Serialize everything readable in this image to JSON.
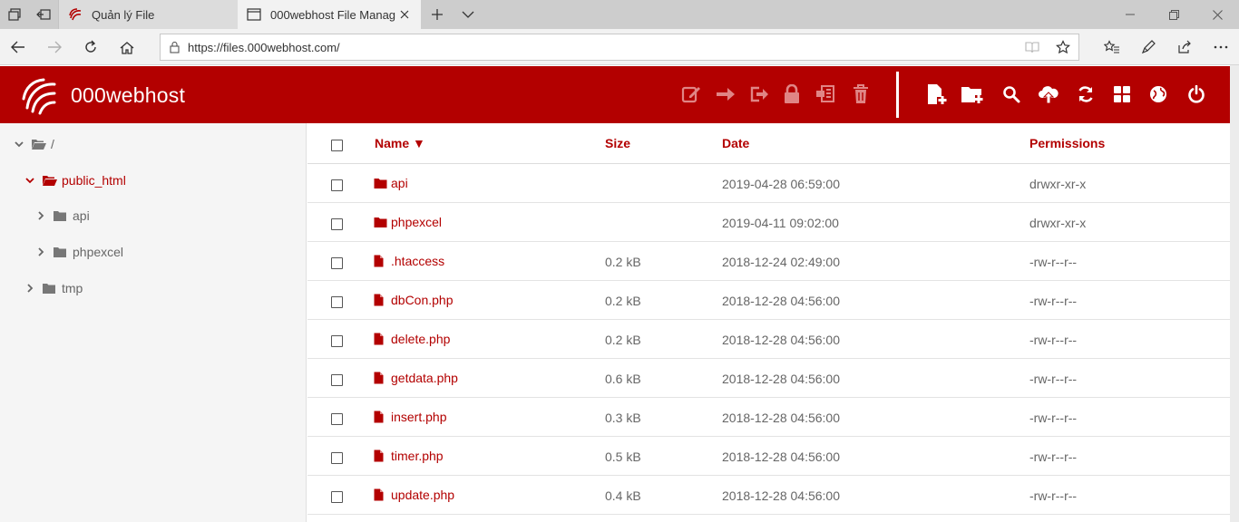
{
  "browser": {
    "tabs": [
      {
        "title": "Quản lý File"
      },
      {
        "title": "000webhost File Manag"
      }
    ],
    "url": "https://files.000webhost.com/"
  },
  "app": {
    "brand": "000webhost",
    "colors": {
      "primary": "#b30000",
      "muted_icon": "#e08585",
      "text_muted": "#666666"
    }
  },
  "tree": [
    {
      "label": "/"
    },
    {
      "label": "public_html"
    },
    {
      "label": "api"
    },
    {
      "label": "phpexcel"
    },
    {
      "label": "tmp"
    }
  ],
  "table": {
    "columns": {
      "name": "Name ▼",
      "size": "Size",
      "date": "Date",
      "permissions": "Permissions"
    },
    "rows": [
      {
        "type": "folder",
        "name": "api",
        "size": "",
        "date": "2019-04-28 06:59:00",
        "perms": "drwxr-xr-x"
      },
      {
        "type": "folder",
        "name": "phpexcel",
        "size": "",
        "date": "2019-04-11 09:02:00",
        "perms": "drwxr-xr-x"
      },
      {
        "type": "file",
        "name": ".htaccess",
        "size": "0.2 kB",
        "date": "2018-12-24 02:49:00",
        "perms": "-rw-r--r--"
      },
      {
        "type": "file",
        "name": "dbCon.php",
        "size": "0.2 kB",
        "date": "2018-12-28 04:56:00",
        "perms": "-rw-r--r--"
      },
      {
        "type": "file",
        "name": "delete.php",
        "size": "0.2 kB",
        "date": "2018-12-28 04:56:00",
        "perms": "-rw-r--r--"
      },
      {
        "type": "file",
        "name": "getdata.php",
        "size": "0.6 kB",
        "date": "2018-12-28 04:56:00",
        "perms": "-rw-r--r--"
      },
      {
        "type": "file",
        "name": "insert.php",
        "size": "0.3 kB",
        "date": "2018-12-28 04:56:00",
        "perms": "-rw-r--r--"
      },
      {
        "type": "file",
        "name": "timer.php",
        "size": "0.5 kB",
        "date": "2018-12-28 04:56:00",
        "perms": "-rw-r--r--"
      },
      {
        "type": "file",
        "name": "update.php",
        "size": "0.4 kB",
        "date": "2018-12-28 04:56:00",
        "perms": "-rw-r--r--"
      }
    ]
  }
}
